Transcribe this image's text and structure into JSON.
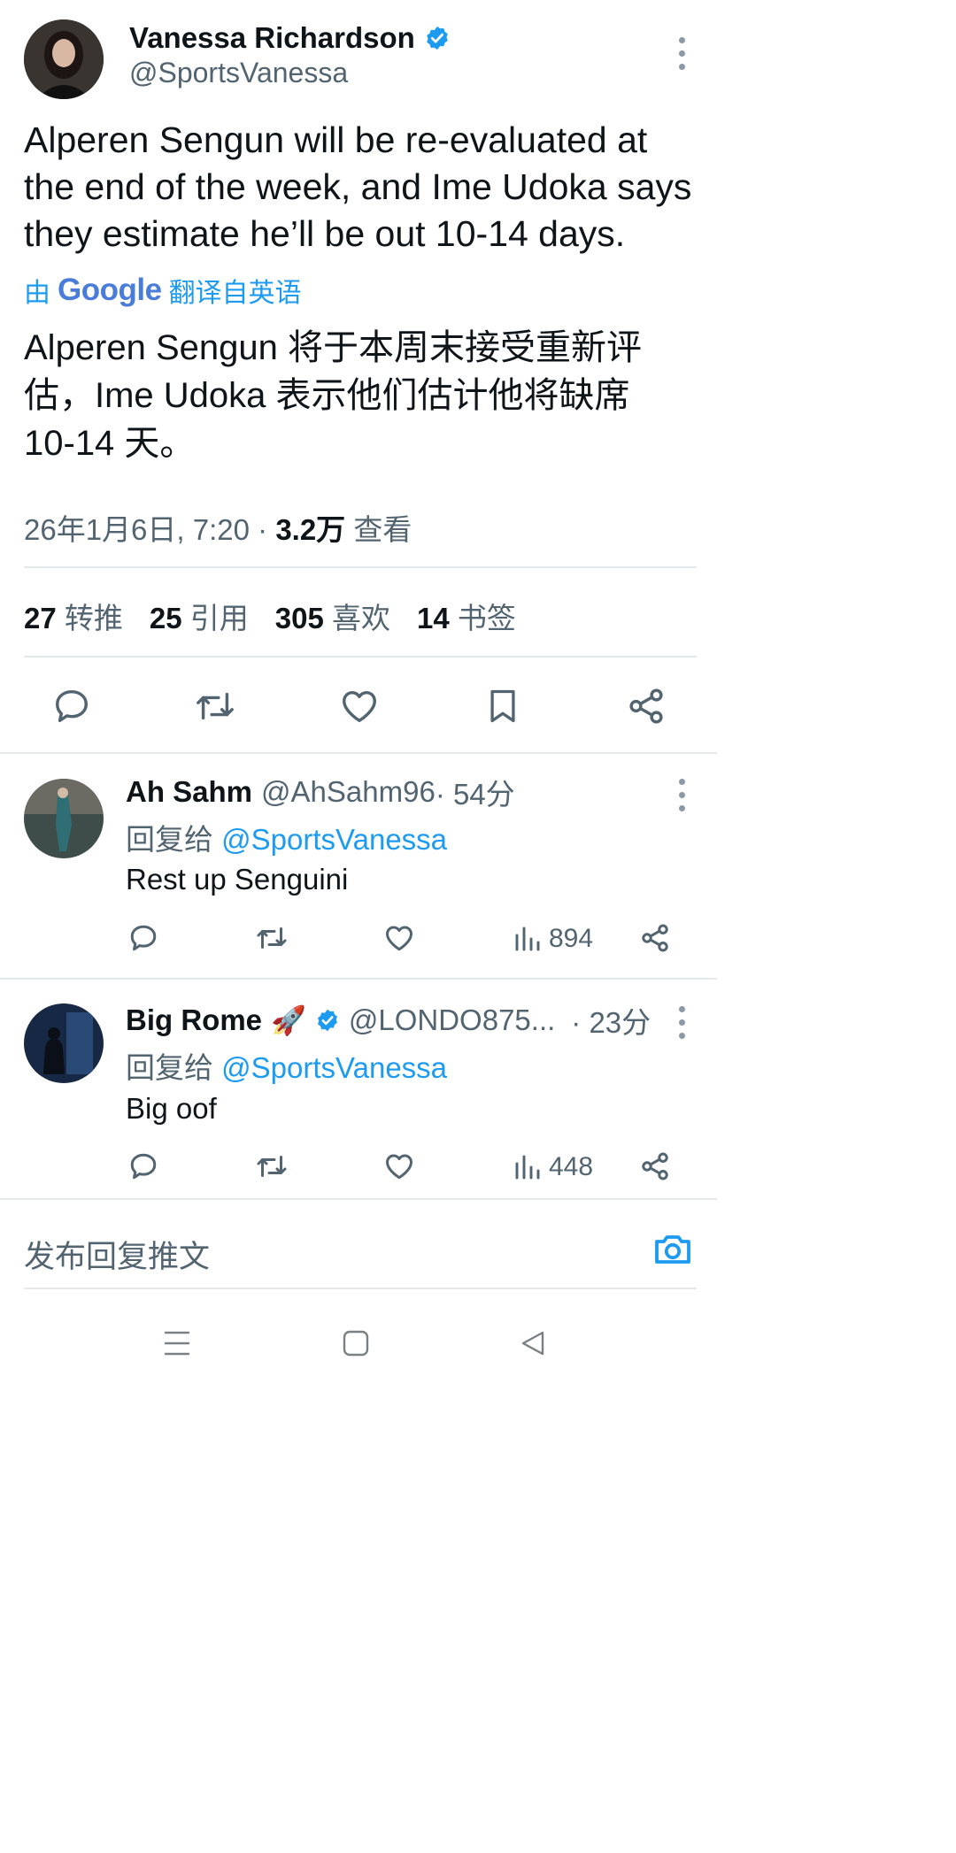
{
  "tweet": {
    "author_name": "Vanessa Richardson",
    "author_handle": "@SportsVanessa",
    "text_lines": [
      "Alperen Sengun will be re-evaluated at",
      "the end of the week, and Ime Udoka says",
      "they estimate he’ll be out 10-14 days."
    ],
    "translated_by": "由",
    "google_word": "Google",
    "translated_from": "翻译自英语",
    "translation_lines": [
      "Alperen Sengun 将于本周末接受重新评",
      "估，Ime Udoka 表示他们估计他将缺席",
      "10-14 天。"
    ],
    "timestamp": "26年1月6日, 7:20 · ",
    "views": "3.2万",
    "views_label": " 查看",
    "stats": {
      "retweets_count": "27",
      "retweets_label": "转推",
      "quotes_count": "25",
      "quotes_label": "引用",
      "likes_count": "305",
      "likes_label": "喜欢",
      "bookmarks_count": "14",
      "bookmarks_label": "书签"
    }
  },
  "replies": [
    {
      "name": "Ah Sahm",
      "handle": "@AhSahm96",
      "time": " · 54分",
      "reply_to_prefix": "回复给",
      "reply_to_handle": "@SportsVanessa",
      "text": "Rest up Senguini",
      "views": "894"
    },
    {
      "name": "Big Rome",
      "emoji": "🚀",
      "handle": "@LONDO875...",
      "time": "· 23分",
      "reply_to_prefix": "回复给",
      "reply_to_handle": "@SportsVanessa",
      "text": "Big oof",
      "views": "448"
    }
  ],
  "composer": {
    "placeholder": "发布回复推文"
  },
  "colors": {
    "accent": "#1d9bf0",
    "text": "#0f1419",
    "muted": "#536471",
    "divider": "#e4e8eb"
  },
  "icons": [
    "more-icon",
    "verified-badge-icon",
    "reply-icon",
    "retweet-icon",
    "like-icon",
    "bookmark-icon",
    "share-icon",
    "views-icon",
    "camera-icon",
    "nav-menu-icon",
    "nav-home-icon",
    "nav-back-icon"
  ]
}
